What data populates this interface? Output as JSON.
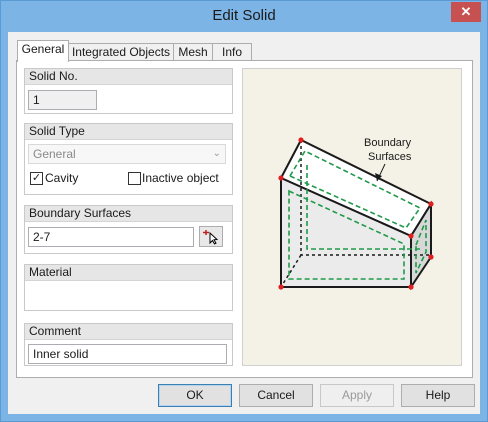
{
  "window": {
    "title": "Edit Solid",
    "close_label": "✕"
  },
  "tabs": [
    {
      "label": "General",
      "active": true
    },
    {
      "label": "Integrated Objects",
      "active": false
    },
    {
      "label": "Mesh",
      "active": false
    },
    {
      "label": "Info",
      "active": false
    }
  ],
  "general": {
    "solid_no": {
      "heading": "Solid No.",
      "value": "1"
    },
    "solid_type": {
      "heading": "Solid Type",
      "selected": "General",
      "cavity_label": "Cavity",
      "cavity_checked": true,
      "inactive_label": "Inactive object",
      "inactive_checked": false
    },
    "boundary_surfaces": {
      "heading": "Boundary Surfaces",
      "value": "2-7"
    },
    "material": {
      "heading": "Material",
      "value": ""
    },
    "comment": {
      "heading": "Comment",
      "value": "Inner solid"
    }
  },
  "illustration": {
    "callout_line1": "Boundary",
    "callout_line2": "Surfaces",
    "accent_color": "#1f9a4a",
    "vertex_color": "#e02020"
  },
  "buttons": {
    "ok": "OK",
    "cancel": "Cancel",
    "apply": "Apply",
    "help": "Help"
  },
  "colors": {
    "titlebar": "#7db4e6",
    "panel_bg": "#f4f2e6"
  }
}
